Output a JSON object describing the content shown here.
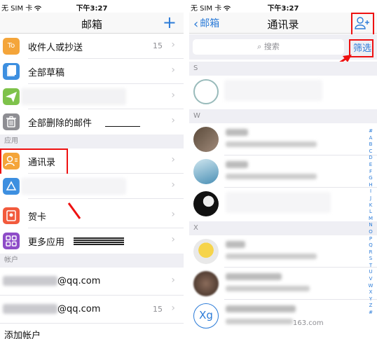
{
  "left": {
    "status": {
      "carrier": "无 SIM 卡",
      "time": "下午3:27"
    },
    "nav": {
      "title": "邮箱",
      "add": "+"
    },
    "rows": [
      {
        "label": "收件人或抄送",
        "count": "15",
        "icon_text": "To",
        "icon_color": "#f4a53a"
      },
      {
        "label": "全部草稿",
        "count": "",
        "icon_color": "#3d8fe0"
      },
      {
        "label": "",
        "count": "",
        "icon_color": "#7ec24a"
      },
      {
        "label": "全部删除的邮件",
        "count": "",
        "icon_color": "#8e8e93"
      }
    ],
    "section_apps": "应用",
    "app_rows": [
      {
        "label": "通讯录",
        "icon_color": "#f4a53a"
      },
      {
        "label": "",
        "icon_color": "#3d8fe0"
      },
      {
        "label": "贺卡",
        "icon_color": "#f25a3c"
      },
      {
        "label": "更多应用",
        "icon_color": "#8e4cc8"
      }
    ],
    "section_accounts": "帐户",
    "accounts": [
      {
        "label": "@qq.com",
        "count": ""
      },
      {
        "label": "@qq.com",
        "count": "15"
      }
    ],
    "bottom_partial": "添加帐户"
  },
  "right": {
    "status": {
      "carrier": "无 SIM 卡",
      "time": "下午3:27"
    },
    "nav": {
      "back": "邮箱",
      "title": "通讯录"
    },
    "search": {
      "placeholder": "搜索",
      "filter": "筛选"
    },
    "sections": [
      "S",
      "W",
      "X"
    ],
    "last_contact": {
      "initials": "Xg",
      "email_suffix": "163.com"
    },
    "index_letters": [
      "#",
      "A",
      "B",
      "C",
      "D",
      "E",
      "F",
      "G",
      "H",
      "I",
      "J",
      "K",
      "L",
      "M",
      "N",
      "O",
      "P",
      "Q",
      "R",
      "S",
      "T",
      "U",
      "V",
      "W",
      "X",
      "Y",
      "Z",
      "#"
    ]
  },
  "colors": {
    "accent": "#2b7bd8",
    "annotation": "#e11111"
  }
}
